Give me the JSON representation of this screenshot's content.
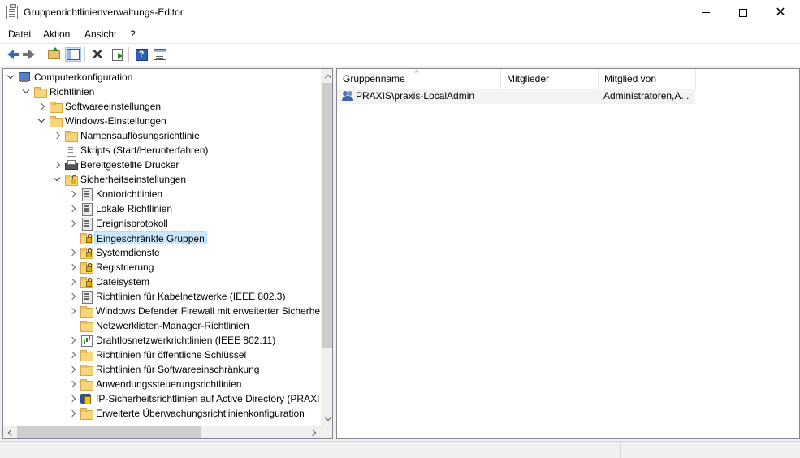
{
  "window": {
    "title": "Gruppenrichtlinienverwaltungs-Editor",
    "controls": {
      "minimize": "",
      "maximize": "",
      "close": "✕"
    }
  },
  "menu": [
    "Datei",
    "Aktion",
    "Ansicht",
    "?"
  ],
  "toolbar": {
    "buttons": [
      "back-icon",
      "forward-icon",
      "up-folder-icon",
      "show-hide-tree-icon",
      "delete-icon",
      "export-list-icon",
      "help-icon",
      "properties-icon"
    ],
    "help_glyph": "?",
    "delete_glyph": "✕"
  },
  "tree": {
    "items": [
      {
        "label": "Computerkonfiguration",
        "icon": "computer-icon",
        "expanded": true,
        "level": 0
      },
      {
        "label": "Richtlinien",
        "icon": "folder-icon",
        "expanded": true,
        "level": 1
      },
      {
        "label": "Softwareeinstellungen",
        "icon": "folder-icon",
        "expanded": false,
        "level": 2
      },
      {
        "label": "Windows-Einstellungen",
        "icon": "folder-icon",
        "expanded": true,
        "level": 2
      },
      {
        "label": "Namensauflösungsrichtlinie",
        "icon": "folder-icon",
        "expanded": false,
        "level": 3
      },
      {
        "label": "Skripts (Start/Herunterfahren)",
        "icon": "script-icon",
        "level": 3
      },
      {
        "label": "Bereitgestellte Drucker",
        "icon": "printer-icon",
        "expanded": false,
        "level": 3
      },
      {
        "label": "Sicherheitseinstellungen",
        "icon": "security-settings-icon",
        "expanded": true,
        "level": 3
      },
      {
        "label": "Kontorichtlinien",
        "icon": "policy-icon",
        "expanded": false,
        "level": 4
      },
      {
        "label": "Lokale Richtlinien",
        "icon": "policy-icon",
        "expanded": false,
        "level": 4
      },
      {
        "label": "Ereignisprotokoll",
        "icon": "policy-icon",
        "expanded": false,
        "level": 4
      },
      {
        "label": "Eingeschränkte Gruppen",
        "icon": "lock-folder-icon",
        "level": 4,
        "selected": true
      },
      {
        "label": "Systemdienste",
        "icon": "lock-folder-icon",
        "expanded": false,
        "level": 4
      },
      {
        "label": "Registrierung",
        "icon": "lock-folder-icon",
        "expanded": false,
        "level": 4
      },
      {
        "label": "Dateisystem",
        "icon": "lock-folder-icon",
        "expanded": false,
        "level": 4
      },
      {
        "label": "Richtlinien für Kabelnetzwerke (IEEE 802.3)",
        "icon": "policy-icon",
        "expanded": false,
        "level": 4
      },
      {
        "label": "Windows Defender Firewall mit erweiterter Sicherhe",
        "icon": "folder-icon",
        "expanded": false,
        "level": 4
      },
      {
        "label": "Netzwerklisten-Manager-Richtlinien",
        "icon": "folder-icon",
        "level": 4
      },
      {
        "label": "Drahtlosnetzwerkrichtlinien (IEEE 802.11)",
        "icon": "wireless-policy-icon",
        "expanded": false,
        "level": 4
      },
      {
        "label": "Richtlinien für öffentliche Schlüssel",
        "icon": "folder-icon",
        "expanded": false,
        "level": 4
      },
      {
        "label": "Richtlinien für Softwareeinschränkung",
        "icon": "folder-icon",
        "expanded": false,
        "level": 4
      },
      {
        "label": "Anwendungssteuerungsrichtlinien",
        "icon": "folder-icon",
        "expanded": false,
        "level": 4
      },
      {
        "label": "IP-Sicherheitsrichtlinien auf Active Directory (PRAXI",
        "icon": "ipsec-icon",
        "expanded": false,
        "level": 4
      },
      {
        "label": "Erweiterte Überwachungsrichtlinienkonfiguration",
        "icon": "folder-icon",
        "expanded": false,
        "level": 4
      }
    ]
  },
  "list": {
    "columns": [
      "Gruppenname",
      "Mitglieder",
      "Mitglied von"
    ],
    "sort_indicator": "^",
    "rows": [
      {
        "name": "PRAXIS\\praxis-LocalAdmin",
        "members": "",
        "member_of": "Administratoren,A..."
      }
    ]
  },
  "colors": {
    "selection": "#cce8ff",
    "folder": "#f7d57a",
    "accent": "#2e6fc0"
  }
}
